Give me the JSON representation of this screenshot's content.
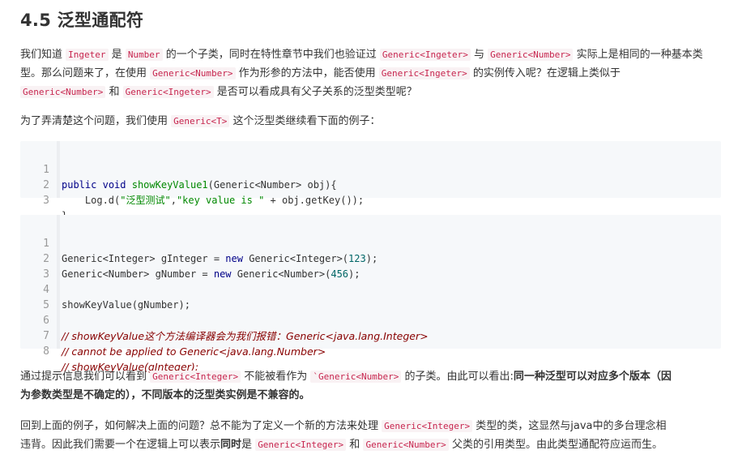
{
  "heading": "4.5 泛型通配符",
  "para1": {
    "t1": "我们知道",
    "c1": "Ingeter",
    "t2": "是",
    "c2": "Number",
    "t3": "的一个子类，同时在特性章节中我们也验证过",
    "c3": "Generic<Ingeter>",
    "t4": "与",
    "c4": "Generic<Number>",
    "t5": "实际上是相同的一种基",
    "t6": "本类型。那么问题来了，在使用",
    "c5": "Generic<Number>",
    "t7": "作为形参的方法中，能否使用",
    "c6": "Generic<Ingeter>",
    "t8": "的实例传入呢？在逻辑上类似于",
    "c7": "Generic<Number>",
    "t9": "和",
    "c8": "Generic<Ingeter>",
    "t10": "是否可以看成具有父子关系的泛型类型呢？"
  },
  "para2": {
    "t1": "为了弄清楚这个问题，我们使用",
    "c1": "Generic<T>",
    "t2": "这个泛型类继续看下面的例子："
  },
  "code1": {
    "line_numbers": [
      "1",
      "2",
      "3"
    ],
    "l1_kw1": "public",
    "l1_kw2": "void",
    "l1_fn": "showKeyValue1",
    "l1_rest": "(Generic<Number> obj){",
    "l2_a": "    Log.d(",
    "l2_s1": "\"泛型测试\"",
    "l2_b": ",",
    "l2_s2": "\"key value is \"",
    "l2_c": " + obj.getKey());",
    "l3": "}"
  },
  "code2": {
    "line_numbers": [
      "1",
      "2",
      "3",
      "4",
      "5",
      "6",
      "7",
      "8"
    ],
    "l1_a": "Generic<Integer> gInteger = ",
    "l1_kw": "new",
    "l1_b": " Generic<Integer>(",
    "l1_num": "123",
    "l1_c": ");",
    "l2_a": "Generic<Number> gNumber = ",
    "l2_kw": "new",
    "l2_b": " Generic<Number>(",
    "l2_num": "456",
    "l2_c": ");",
    "l4": "showKeyValue(gNumber);",
    "l6": "// showKeyValue这个方法编译器会为我们报错：Generic<java.lang.Integer>",
    "l7": "// cannot be applied to Generic<java.lang.Number>",
    "l8": "// showKeyValue(gInteger);"
  },
  "para3": {
    "t1": "通过提示信息我们可以看到",
    "c1": "Generic<Integer>",
    "t2": "不能被看作为",
    "c2": "`Generic<Number>",
    "t3": "的子类。由此可以看出:",
    "b1": "同一种泛型可以对应多个版本（因",
    "b2": "为参数类型是不确定的），不同版本的泛型类实例是不兼容的。"
  },
  "para4": {
    "t1": "回到上面的例子，如何解决上面的问题？总不能为了定义一个新的方法来处理",
    "c1": "Generic<Integer>",
    "t2": "类型的类，这显然与java中的多台理念相",
    "t3": "违背。因此我们需要一个在逻辑上可以表示",
    "b1": "同时",
    "t4": "是",
    "c2": "Generic<Integer>",
    "t5": "和",
    "c3": "Generic<Number>",
    "t6": "父类的引用类型。由此类型通配符应运而生。"
  }
}
